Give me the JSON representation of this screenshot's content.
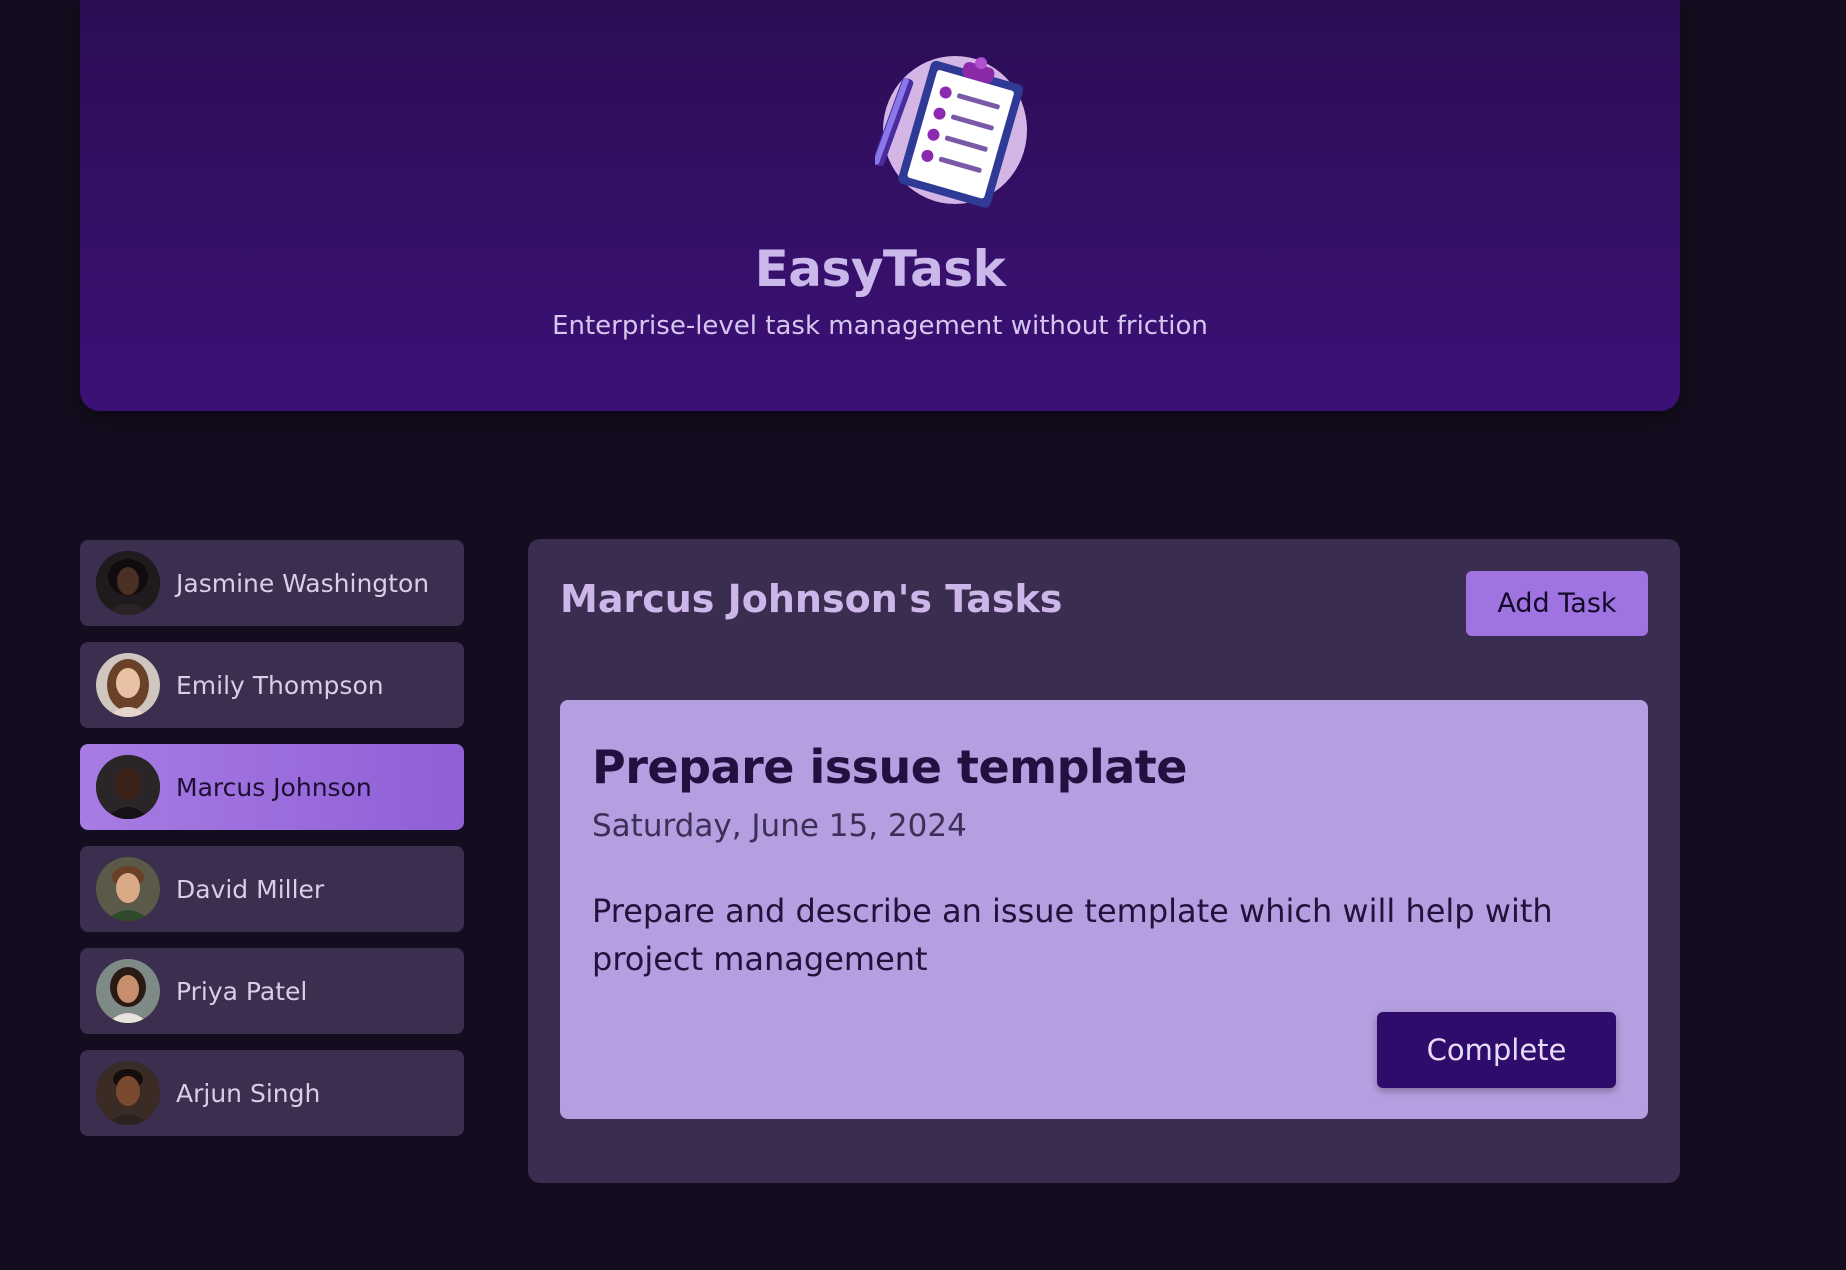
{
  "header": {
    "logo_icon": "clipboard-checklist-icon",
    "title": "EasyTask",
    "subtitle": "Enterprise-level task management without friction"
  },
  "users": [
    {
      "name": "Jasmine Washington",
      "selected": false
    },
    {
      "name": "Emily Thompson",
      "selected": false
    },
    {
      "name": "Marcus Johnson",
      "selected": true
    },
    {
      "name": "David Miller",
      "selected": false
    },
    {
      "name": "Priya Patel",
      "selected": false
    },
    {
      "name": "Arjun Singh",
      "selected": false
    }
  ],
  "tasks_panel": {
    "title": "Marcus Johnson's Tasks",
    "add_task_label": "Add Task",
    "task": {
      "title": "Prepare issue template",
      "date": "Saturday, June 15, 2024",
      "description": "Prepare and describe an issue template which will help with project management",
      "complete_label": "Complete"
    }
  },
  "colors": {
    "background": "#130d1f",
    "header_gradient_top": "#2b0e54",
    "header_gradient_bottom": "#3c1177",
    "accent": "#9f74e0",
    "card": "#b69fe0",
    "complete_button": "#2e0c6b"
  }
}
